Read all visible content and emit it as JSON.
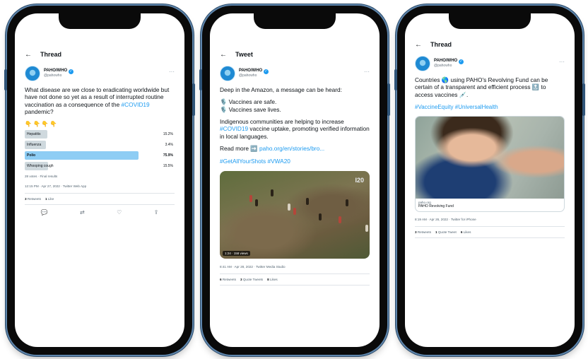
{
  "phone1": {
    "nav_back": "←",
    "nav_title": "Thread",
    "author_name": "PAHO/WHO",
    "author_handle": "@pahowho",
    "verified": "✓",
    "more": "···",
    "text": "What disease are we close to eradicating worldwide but have not done so yet as a result of interrupted routine vaccination as a consequence of the",
    "hashtag": "#COVID19",
    "text_end": " pandemic?",
    "emoji_row": "👇👇👇👇",
    "poll": [
      {
        "label": "Hepatitis",
        "pct": "15.2%",
        "share": 0.152,
        "winner": false
      },
      {
        "label": "Influenza",
        "pct": "3.4%",
        "share": 0.034,
        "winner": false
      },
      {
        "label": "Polio",
        "pct": "75.9%",
        "share": 0.759,
        "winner": true
      },
      {
        "label": "Whooping cough",
        "pct": "15.5%",
        "share": 0.155,
        "winner": false
      }
    ],
    "poll_meta": "28 votes · Final results",
    "timestamp": "12:15 PM · Apr 27, 2022 · Twitter Web App",
    "stats": [
      {
        "count": "3",
        "label": "Retweets"
      },
      {
        "count": "1",
        "label": "Like"
      }
    ],
    "actions": {
      "reply": "💬",
      "retweet": "⇄",
      "like": "♡",
      "share": "⇪"
    }
  },
  "phone2": {
    "nav_back": "←",
    "nav_title": "Tweet",
    "author_name": "PAHO/WHO",
    "author_handle": "@pahowho",
    "verified": "✓",
    "more": "···",
    "line1": "Deep in the Amazon, a message can be heard:",
    "line2": "🎙️ Vaccines are safe.",
    "line3": "🎙️ Vaccines save lives.",
    "para2_start": "Indigenous communities are helping to increase ",
    "para2_hashtag": "#COVID19",
    "para2_end": " vaccine uptake, promoting verified information in local languages.",
    "read_more": "Read more ➡️ ",
    "read_more_link": "paho.org/en/stories/bro...",
    "hashtags": "#GetAllYourShots #VWA20",
    "video_watermark": "I20",
    "video_duration": "1:24 · 158 views",
    "timestamp": "8:41 AM · Apr 28, 2022 · Twitter Media Studio",
    "stats": [
      {
        "count": "6",
        "label": "Retweets"
      },
      {
        "count": "3",
        "label": "Quote Tweets"
      },
      {
        "count": "8",
        "label": "Likes"
      }
    ]
  },
  "phone3": {
    "nav_back": "←",
    "nav_title": "Thread",
    "author_name": "PAHO/WHO",
    "author_handle": "@pahowho",
    "verified": "✓",
    "more": "···",
    "text": "Countries 🌎 using PAHO's Revolving Fund can be certain of a transparent and efficient process 🔝 to access vaccines 💉.",
    "hashtags": "#VaccineEquity #UniversalHealth",
    "card_domain": "paho.org",
    "card_title": "PAHO Revolving Fund",
    "timestamp": "8:19 AM · Apr 26, 2022 · Twitter for iPhone",
    "stats": [
      {
        "count": "3",
        "label": "Retweets"
      },
      {
        "count": "1",
        "label": "Quote Tweet"
      },
      {
        "count": "6",
        "label": "Likes"
      }
    ]
  }
}
